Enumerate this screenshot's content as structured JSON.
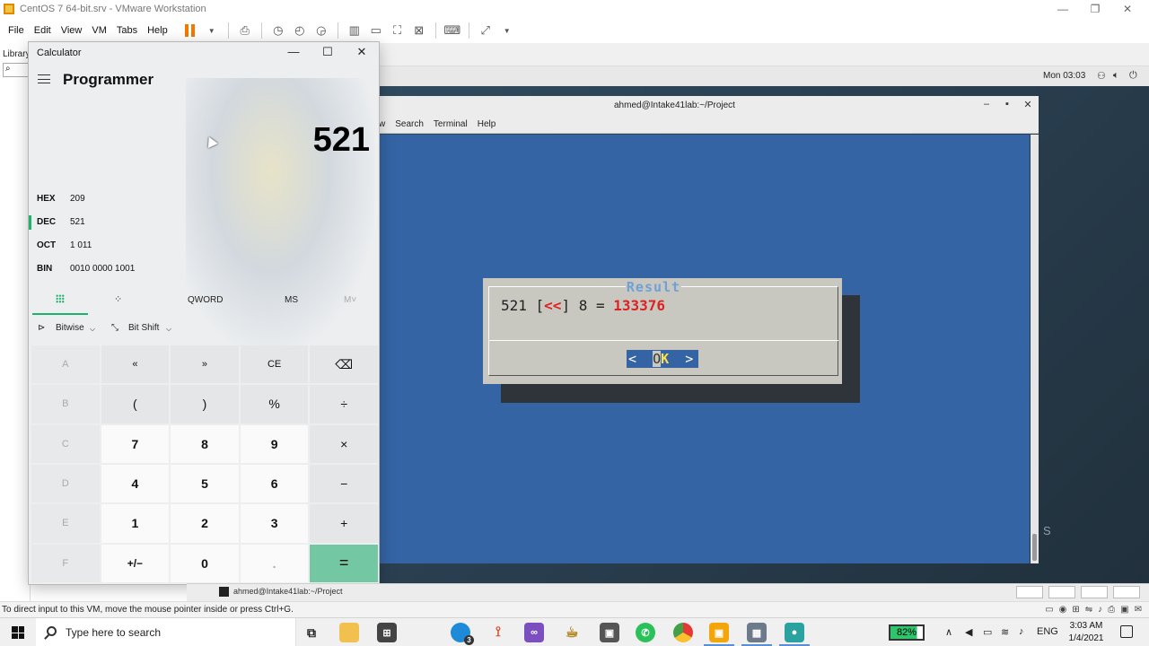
{
  "vmware": {
    "title": "CentOS 7 64-bit.srv - VMware Workstation",
    "menu": [
      "File",
      "Edit",
      "View",
      "VM",
      "Tabs",
      "Help"
    ],
    "library_label": "Library",
    "status_hint": "To direct input to this VM, move the mouse pointer inside or press Ctrl+G.",
    "window_controls": [
      "—",
      "❐",
      "✕"
    ]
  },
  "guest": {
    "clock": "Mon 03:03",
    "terminal": {
      "title": "ahmed@Intake41lab:~/Project",
      "menu": [
        "Search",
        "Terminal",
        "Help"
      ],
      "menu_partial": "w"
    },
    "dialog": {
      "title": "Result",
      "operand1": "521",
      "operator": "<<",
      "operand2": "8",
      "result": "133376",
      "ok_label": "OK"
    }
  },
  "calculator": {
    "window_title": "Calculator",
    "mode": "Programmer",
    "display": "521",
    "radix": [
      {
        "label": "HEX",
        "value": "209"
      },
      {
        "label": "DEC",
        "value": "521"
      },
      {
        "label": "OCT",
        "value": "1 011"
      },
      {
        "label": "BIN",
        "value": "0010 0000 1001"
      }
    ],
    "active_radix": "DEC",
    "tabs": {
      "word_size": "QWORD",
      "memory_store": "MS",
      "memory_menu": "M˅"
    },
    "ops": {
      "bitwise": "Bitwise",
      "bitshift": "Bit Shift"
    },
    "keys": [
      [
        "A",
        "«",
        "»",
        "CE",
        "⌫"
      ],
      [
        "B",
        "(",
        ")",
        "%",
        "÷"
      ],
      [
        "C",
        "7",
        "8",
        "9",
        "×"
      ],
      [
        "D",
        "4",
        "5",
        "6",
        "−"
      ],
      [
        "E",
        "1",
        "2",
        "3",
        "+"
      ],
      [
        "F",
        "+/−",
        "0",
        ".",
        "="
      ]
    ]
  },
  "preview_strip": {
    "item": "ahmed@Intake41lab:~/Project"
  },
  "taskbar": {
    "search_placeholder": "Type here to search",
    "battery": "82%",
    "language": "ENG",
    "time": "3:03 AM",
    "date": "1/4/2021",
    "edge_badge": "3"
  },
  "colors": {
    "terminal_bg": "#3464a4",
    "dialog_bg": "#c8c8c0",
    "accent_green": "#1db36b",
    "equals_key": "#73c7a3",
    "result_red": "#dd2222"
  }
}
